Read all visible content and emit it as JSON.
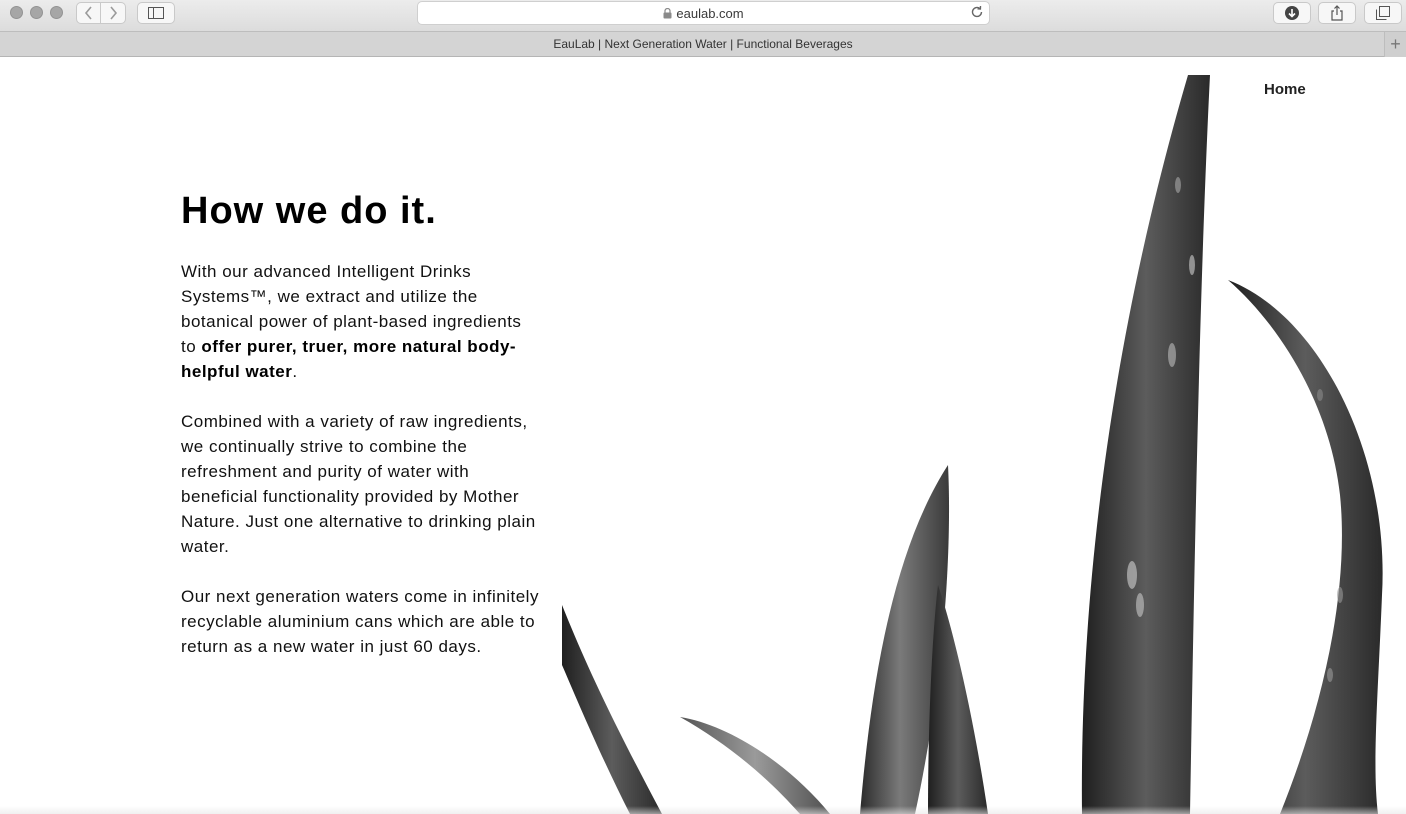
{
  "browser": {
    "url": "eaulab.com",
    "tab_title": "EauLab | Next Generation Water | Functional Beverages",
    "new_tab_label": "+"
  },
  "nav": {
    "home_label": "Home"
  },
  "main": {
    "heading": "How we do it.",
    "p1_text": "With our advanced Intelligent Drinks Systems™, we extract and utilize the botanical power of plant-based ingredients to ",
    "p1_bold": "offer purer, truer, more natural body-helpful water",
    "p1_end": ".",
    "p2": "Combined with a variety of raw ingredients, we continually strive to combine the refreshment and purity of water with beneficial functionality provided by Mother Nature. Just one alternative to drinking plain water.",
    "p3": "Our next generation waters come in infinitely recyclable aluminium cans which are able to return as a new water in just 60 days."
  },
  "colors": {
    "text": "#111111",
    "plant_dark": "#2e2e2e",
    "plant_light": "#8a8a8a"
  }
}
